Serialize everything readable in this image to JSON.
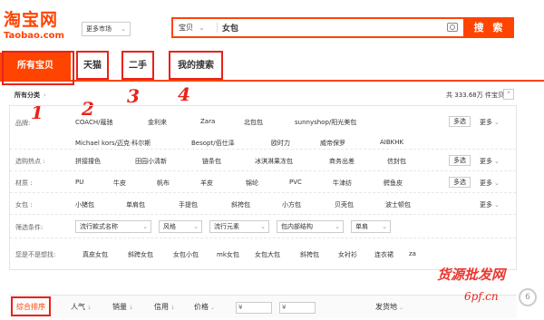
{
  "logo": {
    "cn": "淘宝网",
    "en": "Taobao.com"
  },
  "market": {
    "label": "更多市场",
    "arrow": "⌄"
  },
  "search": {
    "category": "宝贝",
    "category_arrow": "⌄",
    "query": "女包",
    "button": "搜 索"
  },
  "tabs": [
    {
      "label": "所有宝贝",
      "active": true
    },
    {
      "label": "天猫"
    },
    {
      "label": "二手"
    },
    {
      "label": "我的搜索"
    }
  ],
  "annotations": [
    "1",
    "2",
    "3",
    "4"
  ],
  "all_categories": {
    "label": "所有分类",
    "chevron": "›"
  },
  "result_count": "共 333.68万 件宝贝",
  "collapse_icon": "⌃",
  "filters": {
    "brand": {
      "label": "品牌:",
      "values_row1": [
        "COACH/蔻驰",
        "金利来",
        "Zara",
        "北包包",
        "sunnyshop/阳光美包"
      ],
      "values_row2": [
        "Michael kors/迈克·科尔斯",
        "Besopt/佰仕泽",
        "欧时力",
        "威帝保罗",
        "AIBKHK"
      ],
      "multi": "多选",
      "more": "更多"
    },
    "hot": {
      "label": "选购热点 :",
      "values": [
        "拼接撞色",
        "田园小清新",
        "链条包",
        "冰淇淋果冻包",
        "商务出差",
        "信封包"
      ],
      "multi": "多选",
      "more": "更多"
    },
    "material": {
      "label": "材质 :",
      "values": [
        "PU",
        "牛皮",
        "帆布",
        "羊皮",
        "锦纶",
        "PVC",
        "牛津纺",
        "鳄鱼皮"
      ],
      "multi": "多选",
      "more": "更多"
    },
    "bag": {
      "label": "女包 :",
      "values": [
        "小猪包",
        "单肩包",
        "手提包",
        "斜挎包",
        "小方包",
        "贝壳包",
        "波士顿包"
      ],
      "more": "更多"
    },
    "conditions": {
      "label": "筛选条件:",
      "dropdowns": [
        "流行款式名称",
        "风格",
        "流行元素",
        "包内部结构",
        "单肩"
      ]
    },
    "looking": {
      "label": "您是不是想找:",
      "values": [
        "真皮女包",
        "斜跨女包",
        "女包小包",
        "mk女包",
        "女包大包",
        "斜挎包",
        "女衬衫",
        "连衣裙",
        "za"
      ]
    }
  },
  "sort": {
    "items": [
      "综合排序",
      "人气",
      "销量",
      "信用",
      "价格"
    ],
    "price_from": "¥",
    "price_to": "¥",
    "ship": "发货地"
  },
  "watermark": {
    "text": "货源批发网",
    "sub": "6pf.cn",
    "badge": "6"
  }
}
